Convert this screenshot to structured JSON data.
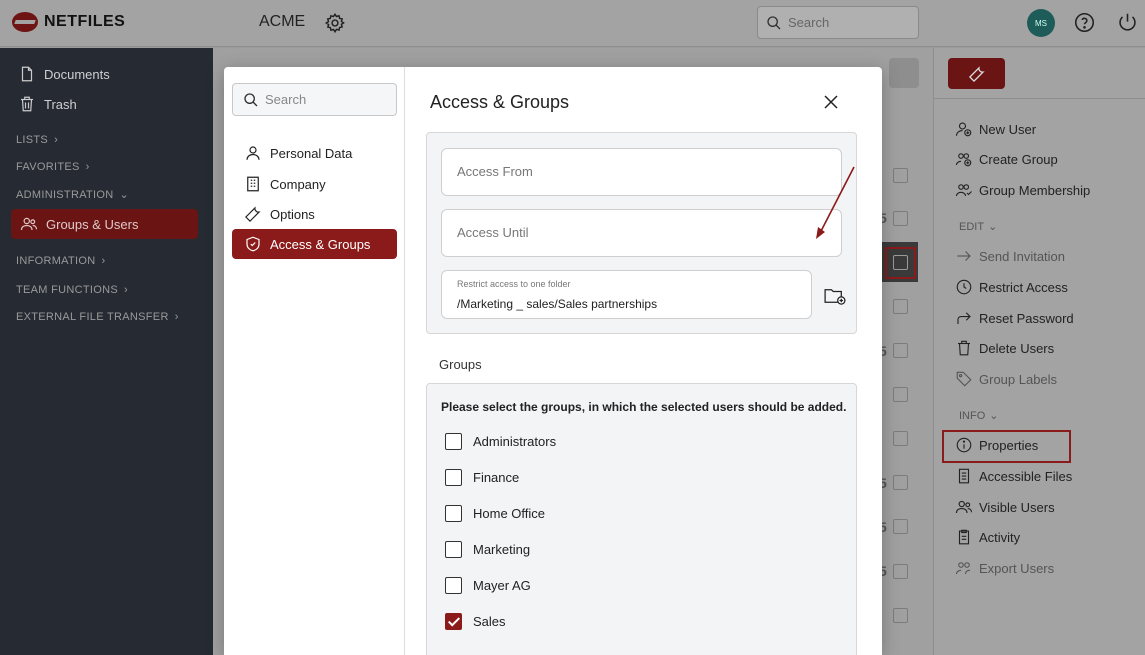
{
  "topbar": {
    "logo_text": "NETFILES",
    "tenant": "ACME",
    "search_placeholder": "Search",
    "avatar_initials": "MS"
  },
  "sidebar": {
    "items": [
      {
        "label": "Documents"
      },
      {
        "label": "Trash"
      }
    ],
    "sections": [
      {
        "label": "LISTS"
      },
      {
        "label": "FAVORITES"
      },
      {
        "label": "ADMINISTRATION"
      },
      {
        "label": "INFORMATION"
      },
      {
        "label": "TEAM FUNCTIONS"
      },
      {
        "label": "EXTERNAL FILE TRANSFER"
      }
    ],
    "active_item": "Groups & Users"
  },
  "background_numbers": [
    "5",
    "5",
    "5",
    "5",
    "5"
  ],
  "right_panel": {
    "items_top": [
      {
        "label": "New User"
      },
      {
        "label": "Create Group"
      },
      {
        "label": "Group Membership"
      }
    ],
    "edit_section": "EDIT",
    "edit_items": [
      {
        "label": "Send Invitation"
      },
      {
        "label": "Restrict Access"
      },
      {
        "label": "Reset Password"
      },
      {
        "label": "Delete Users"
      },
      {
        "label": "Group Labels"
      }
    ],
    "info_section": "INFO",
    "info_items": [
      {
        "label": "Properties"
      },
      {
        "label": "Accessible Files"
      },
      {
        "label": "Visible Users"
      },
      {
        "label": "Activity"
      },
      {
        "label": "Export Users"
      }
    ]
  },
  "modal": {
    "search_placeholder": "Search",
    "nav": [
      {
        "label": "Personal Data"
      },
      {
        "label": "Company"
      },
      {
        "label": "Options"
      },
      {
        "label": "Access & Groups"
      }
    ],
    "title": "Access & Groups",
    "access_from_placeholder": "Access From",
    "access_until_placeholder": "Access Until",
    "restrict_label": "Restrict access to one folder",
    "restrict_value": "/Marketing _ sales/Sales partnerships",
    "groups_title": "Groups",
    "groups_intro": "Please select the groups, in which the selected users should be added.",
    "groups": [
      {
        "label": "Administrators",
        "checked": false
      },
      {
        "label": "Finance",
        "checked": false
      },
      {
        "label": "Home Office",
        "checked": false
      },
      {
        "label": "Marketing",
        "checked": false
      },
      {
        "label": "Mayer AG",
        "checked": false
      },
      {
        "label": "Sales",
        "checked": true
      }
    ]
  },
  "colors": {
    "accent": "#8b1a1a",
    "sidebar_bg": "#252a33",
    "overlay_bg": "#a0a0a0"
  }
}
